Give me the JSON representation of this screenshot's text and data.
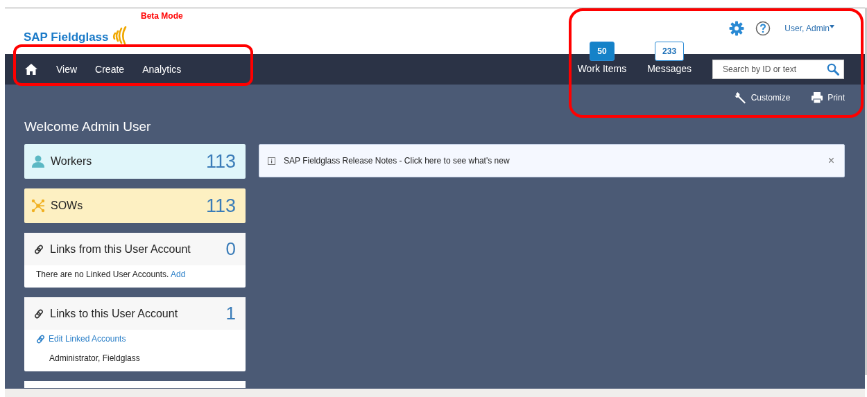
{
  "header": {
    "logo": "SAP Fieldglass",
    "mode_label": "Beta Mode",
    "user_menu": "User, Admin"
  },
  "nav": {
    "items": [
      {
        "label": "View"
      },
      {
        "label": "Create"
      },
      {
        "label": "Analytics"
      }
    ],
    "counters": [
      {
        "count": "50",
        "label": "Work Items",
        "filled": true
      },
      {
        "count": "233",
        "label": "Messages",
        "filled": false
      }
    ],
    "search": {
      "placeholder": "Search by ID or text"
    }
  },
  "toolbar": [
    {
      "kind": "customize",
      "label": "Customize"
    },
    {
      "kind": "print",
      "label": "Print"
    }
  ],
  "welcome": "Welcome Admin User",
  "tiles": [
    {
      "kind": "workers",
      "label": "Workers",
      "count": "113"
    },
    {
      "kind": "sows",
      "label": "SOWs",
      "count": "113"
    }
  ],
  "cards": [
    {
      "title": "Links from this User Account",
      "count": "0",
      "body": "There are no Linked User Accounts.",
      "link": "Add"
    },
    {
      "title": "Links to this User Account",
      "count": "1",
      "edit_link": "Edit Linked Accounts",
      "names": [
        "Administrator, Fieldglass"
      ]
    }
  ],
  "notice": {
    "text": "SAP Fieldglass Release Notes - Click here to see what's new",
    "close": "×"
  }
}
